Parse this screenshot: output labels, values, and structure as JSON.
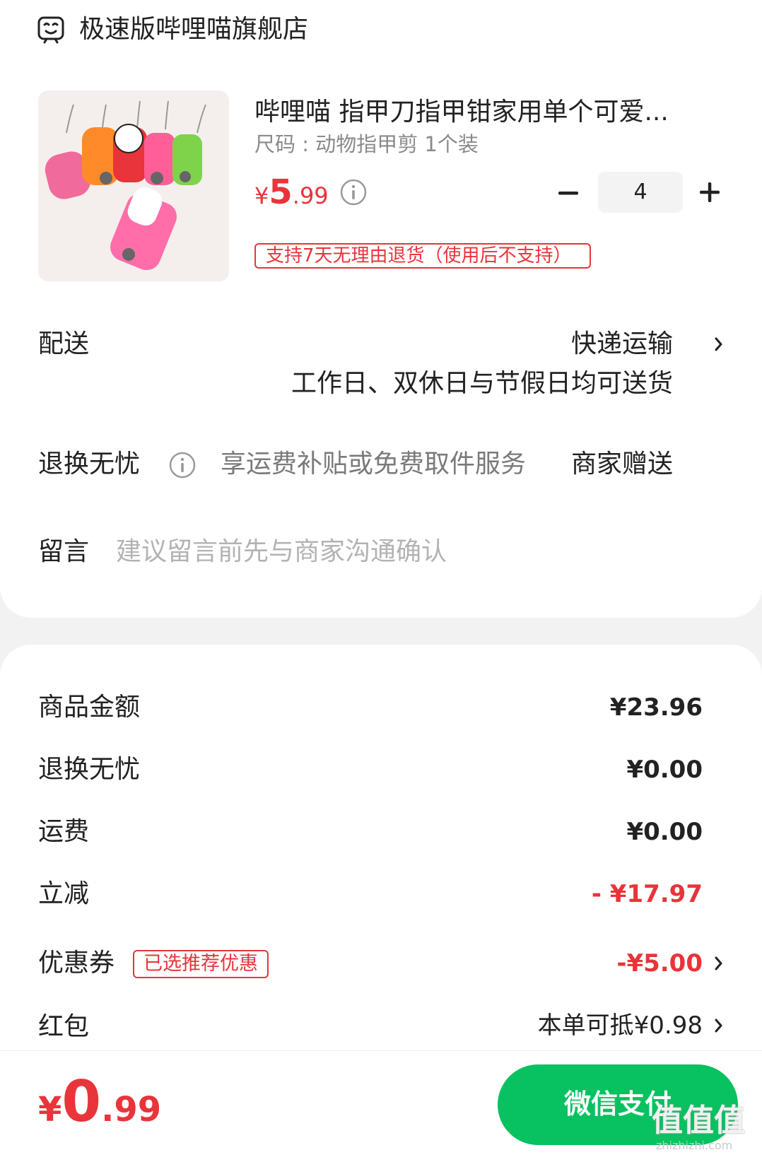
{
  "store": {
    "name": "极速版哔哩喵旗舰店",
    "icon": "store-face-icon"
  },
  "product": {
    "title": "哔哩喵 指甲刀指甲钳家用单个可爱...",
    "spec": "尺码 : 动物指甲剪 1个装",
    "price_currency": "¥",
    "price_int": "5",
    "price_dec": ".99",
    "quantity": "4",
    "return_policy": "支持7天无理由退货（使用后不支持）"
  },
  "shipping": {
    "label": "配送",
    "method": "快递运输",
    "note": "工作日、双休日与节假日均可送货"
  },
  "worry_free": {
    "label": "退换无忧",
    "description": "享运费补贴或免费取件服务",
    "value": "商家赠送"
  },
  "message": {
    "label": "留言",
    "placeholder": "建议留言前先与商家沟通确认"
  },
  "fees": {
    "goods_label": "商品金额",
    "goods_value": "¥23.96",
    "worry_label": "退换无忧",
    "worry_value": "¥0.00",
    "freight_label": "运费",
    "freight_value": "¥0.00",
    "discount_label": "立减",
    "discount_value": "- ¥17.97",
    "coupon_label": "优惠券",
    "coupon_tag": "已选推荐优惠",
    "coupon_value": "-¥5.00",
    "redpacket_label": "红包",
    "redpacket_value": "本单可抵¥0.98"
  },
  "footer": {
    "total_currency": "¥",
    "total_int": "0",
    "total_dec": ".99",
    "pay_label": "微信支付"
  },
  "watermark": {
    "logo": "值值值",
    "url": "zhizhizhi.com"
  },
  "colors": {
    "accent_red": "#e8343a",
    "pay_green": "#08c160",
    "page_bg": "#f2f2f2"
  }
}
